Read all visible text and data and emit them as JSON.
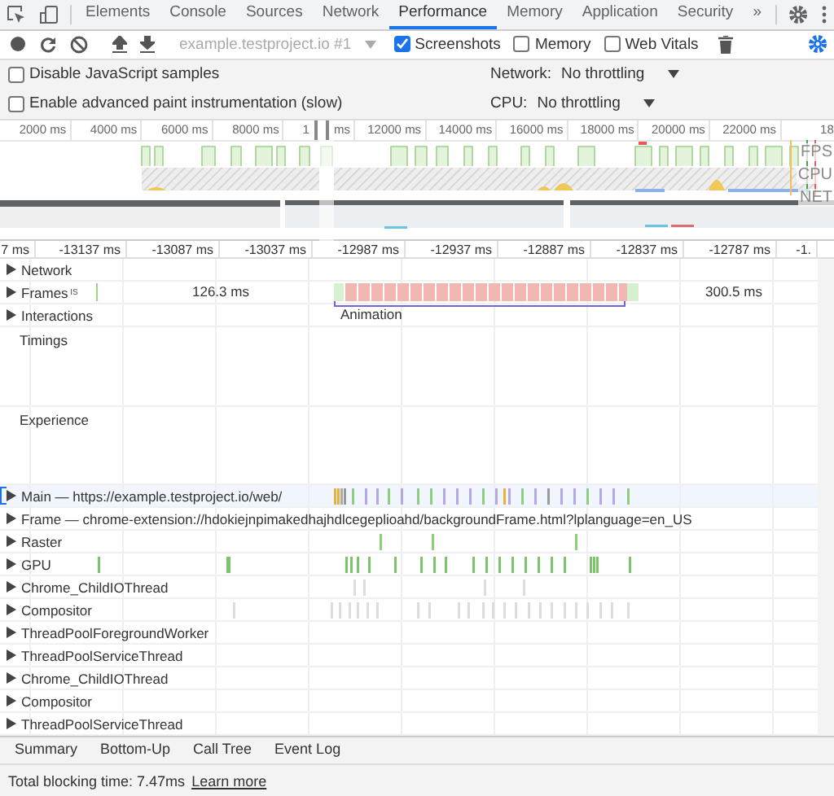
{
  "tabs": [
    {
      "label": "Elements",
      "selected": false
    },
    {
      "label": "Console",
      "selected": false
    },
    {
      "label": "Sources",
      "selected": false
    },
    {
      "label": "Network",
      "selected": false
    },
    {
      "label": "Performance",
      "selected": true
    },
    {
      "label": "Memory",
      "selected": false
    },
    {
      "label": "Application",
      "selected": false
    },
    {
      "label": "Security",
      "selected": false
    }
  ],
  "more_tabs": "»",
  "toolbar": {
    "profile": "example.testproject.io #1",
    "checkboxes": [
      {
        "label": "Screenshots",
        "checked": true
      },
      {
        "label": "Memory",
        "checked": false
      },
      {
        "label": "Web Vitals",
        "checked": false
      }
    ]
  },
  "settings": [
    {
      "label": "Disable JavaScript samples",
      "checked": false,
      "throttle_label": "Network:",
      "throttle_value": "No throttling"
    },
    {
      "label": "Enable advanced paint instrumentation (slow)",
      "checked": false,
      "throttle_label": "CPU:",
      "throttle_value": "No throttling"
    }
  ],
  "overview": {
    "ticks": [
      {
        "label": "2000 ms"
      },
      {
        "label": "4000 ms"
      },
      {
        "label": "6000 ms"
      },
      {
        "label": "8000 ms"
      },
      {
        "label": "1",
        "after_handle": "ms"
      },
      {
        "label": "12000 ms"
      },
      {
        "label": "14000 ms"
      },
      {
        "label": "16000 ms"
      },
      {
        "label": "18000 ms"
      },
      {
        "label": "20000 ms"
      },
      {
        "label": "22000 ms"
      },
      {
        "label": "18"
      }
    ],
    "lanes": [
      "FPS",
      "CPU",
      "NET"
    ]
  },
  "ruler": [
    "7 ms",
    "-13137 ms",
    "-13087 ms",
    "-13037 ms",
    "-12987 ms",
    "-12937 ms",
    "-12887 ms",
    "-12837 ms",
    "-12787 ms",
    "-1."
  ],
  "frames": {
    "cut_label": "ıs",
    "durations": [
      "126.3 ms",
      "300.5 ms"
    ],
    "animation": "Animation"
  },
  "tracks": [
    {
      "label": "Network",
      "kind": "group",
      "expanded": false,
      "selected": false
    },
    {
      "label": "Frames",
      "kind": "frames",
      "expanded": false,
      "selected": false
    },
    {
      "label": "Interactions",
      "kind": "group",
      "expanded": false,
      "selected": false
    },
    {
      "label": "Timings",
      "kind": "section",
      "selected": false
    },
    {
      "label": "Experience",
      "kind": "section",
      "selected": false
    },
    {
      "label": "Main — https://example.testproject.io/web/",
      "kind": "group",
      "expanded": false,
      "selected": true
    },
    {
      "label": "Frame — chrome-extension://hdokiejnpimakedhajhdlcegeplioahd/backgroundFrame.html?lplanguage=en_US",
      "kind": "group",
      "expanded": false,
      "selected": false
    },
    {
      "label": "Raster",
      "kind": "group",
      "expanded": false,
      "selected": false
    },
    {
      "label": "GPU",
      "kind": "group",
      "expanded": false,
      "selected": false
    },
    {
      "label": "Chrome_ChildIOThread",
      "kind": "group",
      "expanded": false,
      "selected": false
    },
    {
      "label": "Compositor",
      "kind": "group",
      "expanded": false,
      "selected": false
    },
    {
      "label": "ThreadPoolForegroundWorker",
      "kind": "group",
      "expanded": false,
      "selected": false
    },
    {
      "label": "ThreadPoolServiceThread",
      "kind": "group",
      "expanded": false,
      "selected": false
    },
    {
      "label": "Chrome_ChildIOThread",
      "kind": "group",
      "expanded": false,
      "selected": false
    },
    {
      "label": "Compositor",
      "kind": "group",
      "expanded": false,
      "selected": false
    },
    {
      "label": "ThreadPoolServiceThread",
      "kind": "group",
      "expanded": false,
      "selected": false
    }
  ],
  "bottom_tabs": [
    {
      "label": "Summary",
      "selected": false
    },
    {
      "label": "Bottom-Up",
      "selected": false
    },
    {
      "label": "Call Tree",
      "selected": false
    },
    {
      "label": "Event Log",
      "selected": false
    }
  ],
  "status": {
    "text": "Total blocking time: 7.47ms",
    "link": "Learn more"
  }
}
